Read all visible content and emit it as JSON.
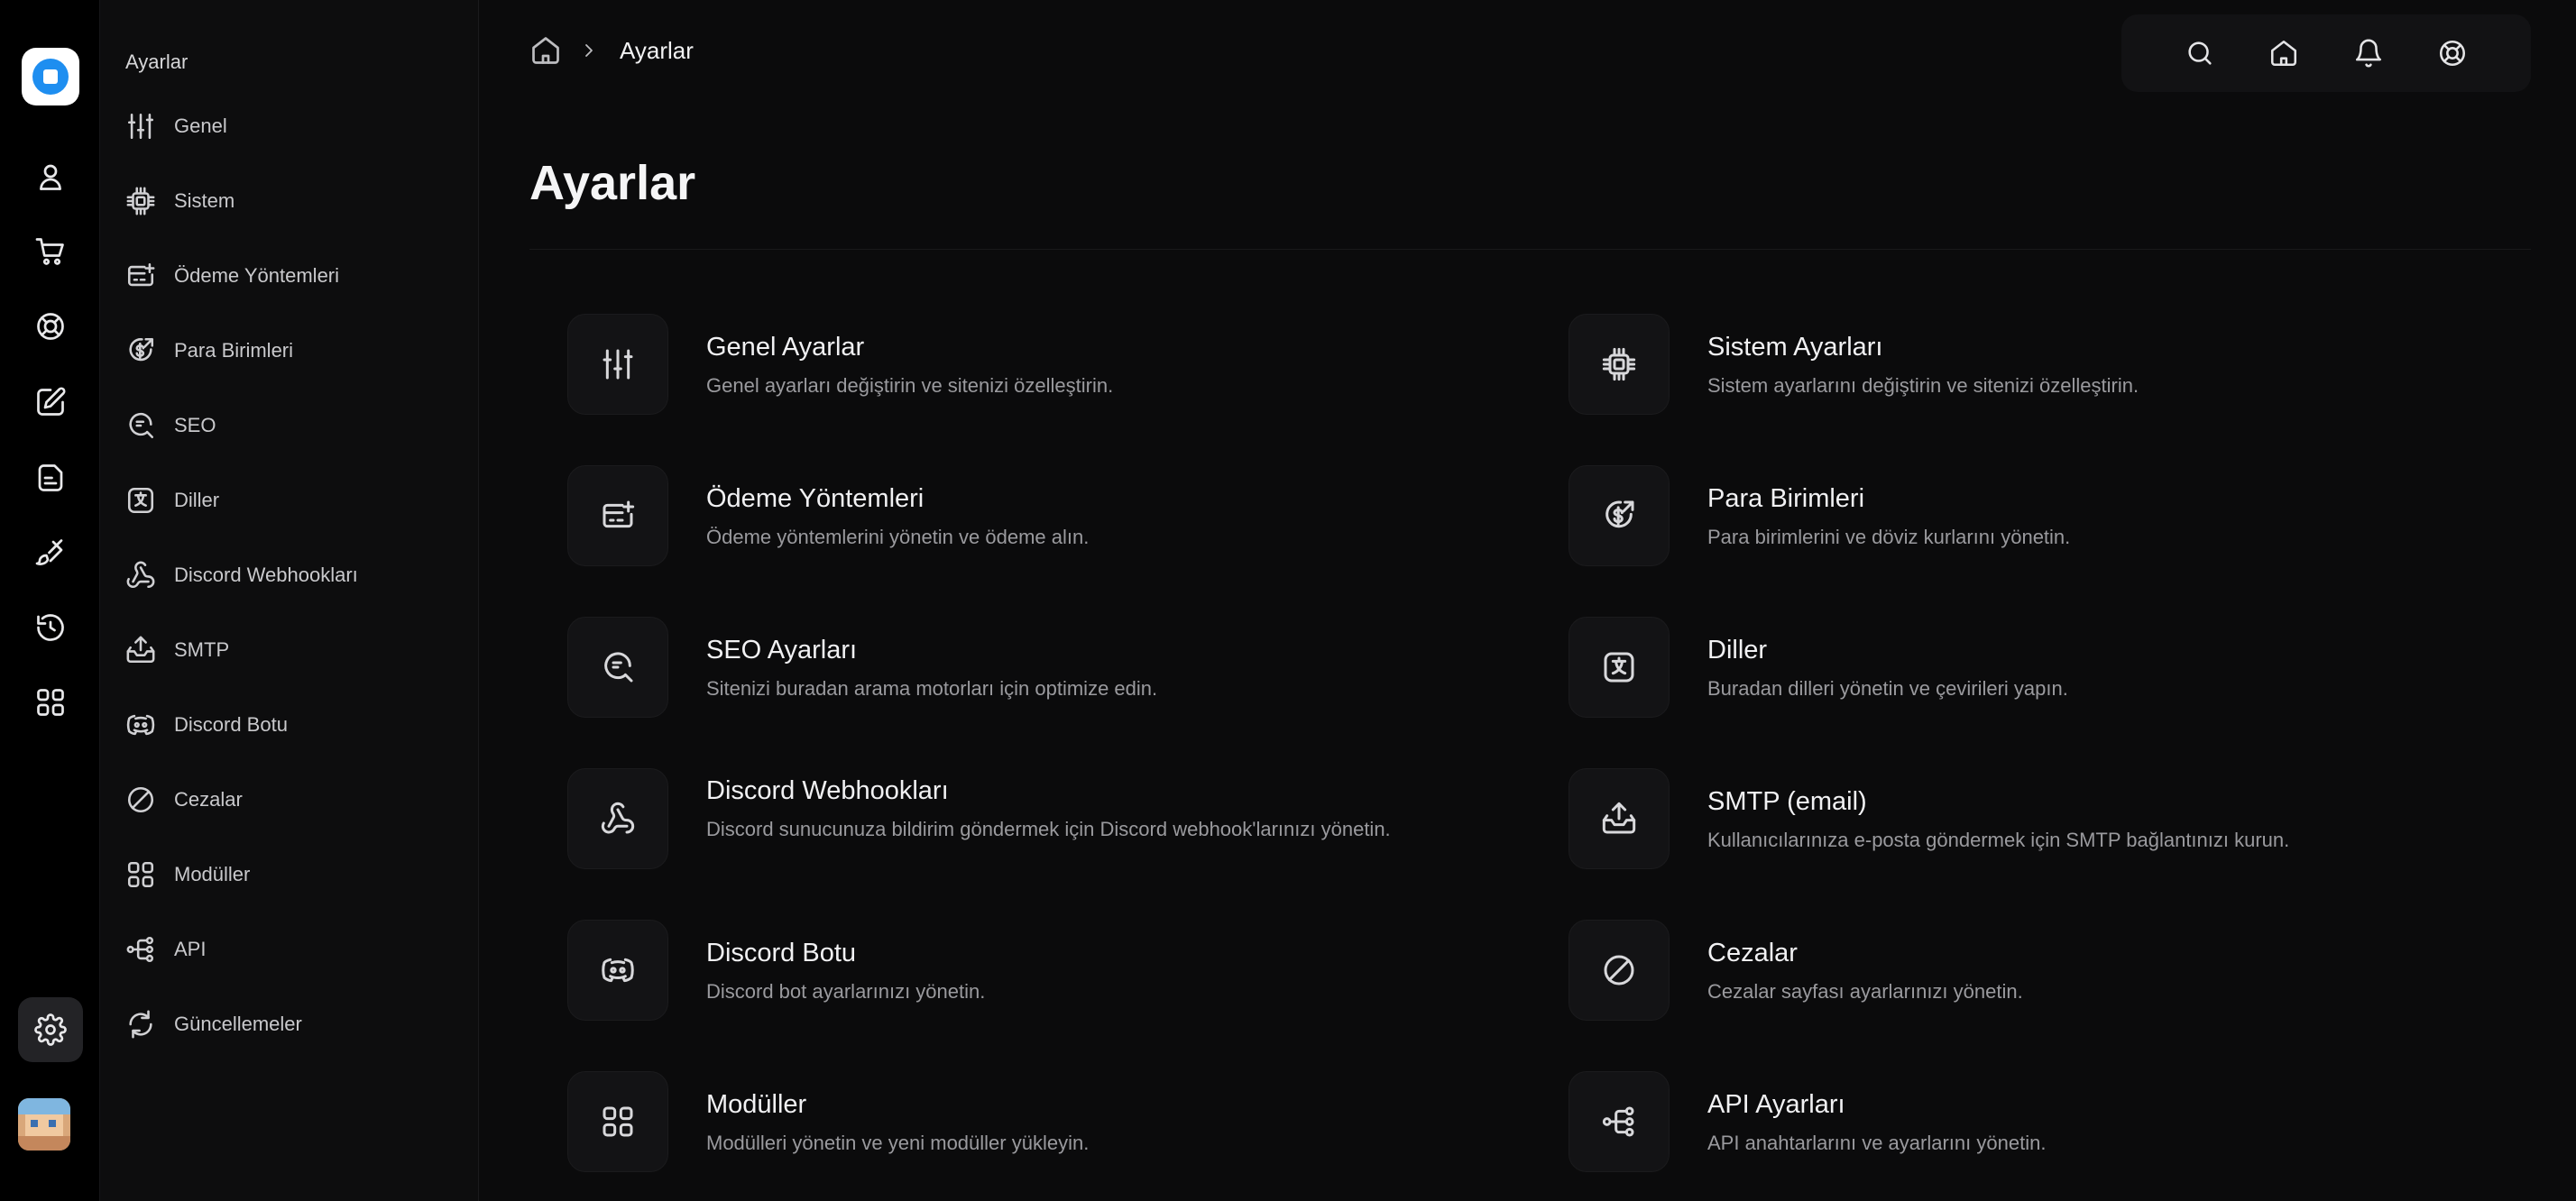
{
  "rail": {
    "items": [
      {
        "icon": "user-icon"
      },
      {
        "icon": "cart-icon"
      },
      {
        "icon": "support-icon"
      },
      {
        "icon": "edit-icon"
      },
      {
        "icon": "document-icon"
      },
      {
        "icon": "brush-icon"
      },
      {
        "icon": "history-icon"
      },
      {
        "icon": "modules-icon"
      }
    ],
    "active": "settings-icon"
  },
  "sidebar": {
    "title": "Ayarlar",
    "items": [
      {
        "label": "Genel",
        "icon": "sliders-icon"
      },
      {
        "label": "Sistem",
        "icon": "cpu-icon"
      },
      {
        "label": "Ödeme Yöntemleri",
        "icon": "payment-icon"
      },
      {
        "label": "Para Birimleri",
        "icon": "currency-icon"
      },
      {
        "label": "SEO",
        "icon": "seo-icon"
      },
      {
        "label": "Diller",
        "icon": "language-icon"
      },
      {
        "label": "Discord Webhookları",
        "icon": "webhook-icon"
      },
      {
        "label": "SMTP",
        "icon": "mail-icon"
      },
      {
        "label": "Discord Botu",
        "icon": "discord-icon"
      },
      {
        "label": "Cezalar",
        "icon": "ban-icon"
      },
      {
        "label": "Modüller",
        "icon": "modules-icon"
      },
      {
        "label": "API",
        "icon": "api-icon"
      },
      {
        "label": "Güncellemeler",
        "icon": "refresh-icon"
      }
    ]
  },
  "breadcrumb": {
    "current": "Ayarlar"
  },
  "topbar": {
    "icons": [
      "search-icon",
      "home-icon",
      "bell-icon",
      "support-icon"
    ]
  },
  "page": {
    "title": "Ayarlar"
  },
  "cards": [
    {
      "title": "Genel Ayarlar",
      "desc": "Genel ayarları değiştirin ve sitenizi özelleştirin.",
      "icon": "sliders-icon"
    },
    {
      "title": "Sistem Ayarları",
      "desc": "Sistem ayarlarını değiştirin ve sitenizi özelleştirin.",
      "icon": "cpu-icon"
    },
    {
      "title": "Ödeme Yöntemleri",
      "desc": "Ödeme yöntemlerini yönetin ve ödeme alın.",
      "icon": "payment-icon"
    },
    {
      "title": "Para Birimleri",
      "desc": "Para birimlerini ve döviz kurlarını yönetin.",
      "icon": "currency-icon"
    },
    {
      "title": "SEO Ayarları",
      "desc": "Sitenizi buradan arama motorları için optimize edin.",
      "icon": "seo-icon"
    },
    {
      "title": "Diller",
      "desc": "Buradan dilleri yönetin ve çevirileri yapın.",
      "icon": "language-icon"
    },
    {
      "title": "Discord Webhookları",
      "desc": "Discord sunucunuza bildirim göndermek için Discord webhook'larınızı yönetin.",
      "icon": "webhook-icon"
    },
    {
      "title": "SMTP (email)",
      "desc": "Kullanıcılarınıza e-posta göndermek için SMTP bağlantınızı kurun.",
      "icon": "mail-icon"
    },
    {
      "title": "Discord Botu",
      "desc": "Discord bot ayarlarınızı yönetin.",
      "icon": "discord-icon"
    },
    {
      "title": "Cezalar",
      "desc": "Cezalar sayfası ayarlarınızı yönetin.",
      "icon": "ban-icon"
    },
    {
      "title": "Modüller",
      "desc": "Modülleri yönetin ve yeni modüller yükleyin.",
      "icon": "modules-icon"
    },
    {
      "title": "API Ayarları",
      "desc": "API anahtarlarını ve ayarlarını yönetin.",
      "icon": "api-icon"
    }
  ]
}
